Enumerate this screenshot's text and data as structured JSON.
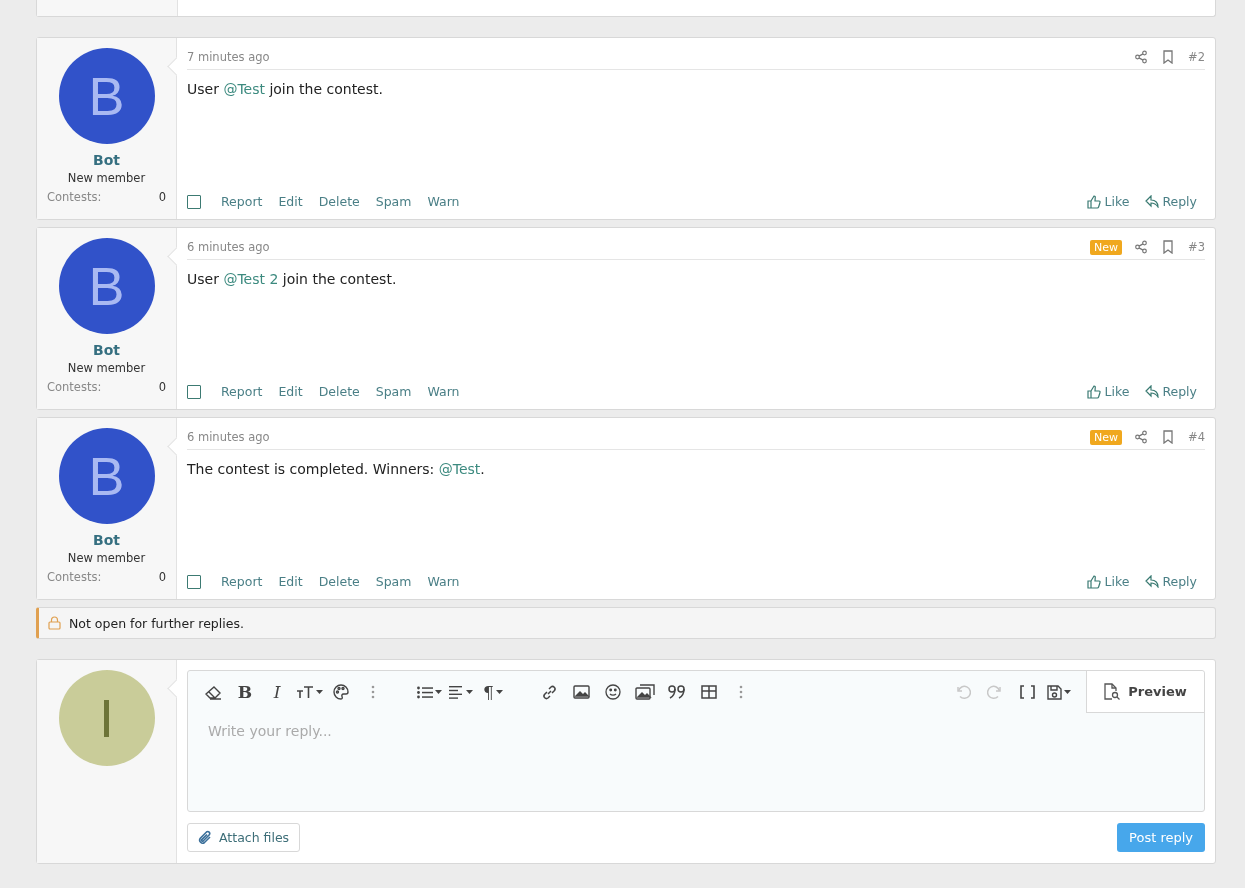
{
  "posts": [
    {
      "avatar_letter": "B",
      "username": "Bot",
      "role": "New member",
      "stat_label": "Contests:",
      "stat_value": "0",
      "time": "7 minutes ago",
      "number": "#2",
      "selected": false,
      "message": [
        {
          "kind": "text",
          "text": "User "
        },
        {
          "kind": "mention",
          "text": "@Test"
        },
        {
          "kind": "text",
          "text": " join the contest."
        }
      ],
      "actions": [
        "Report",
        "Edit",
        "Delete",
        "Spam",
        "Warn"
      ],
      "reactions": [
        "Like",
        "Reply"
      ]
    },
    {
      "avatar_letter": "B",
      "username": "Bot",
      "role": "New member",
      "stat_label": "Contests:",
      "stat_value": "0",
      "time": "6 minutes ago",
      "badge": "New",
      "number": "#3",
      "selected": false,
      "message": [
        {
          "kind": "text",
          "text": "User "
        },
        {
          "kind": "mention",
          "text": "@Test 2"
        },
        {
          "kind": "text",
          "text": " join the contest."
        }
      ],
      "actions": [
        "Report",
        "Edit",
        "Delete",
        "Spam",
        "Warn"
      ],
      "reactions": [
        "Like",
        "Reply"
      ]
    },
    {
      "avatar_letter": "B",
      "username": "Bot",
      "role": "New member",
      "stat_label": "Contests:",
      "stat_value": "0",
      "time": "6 minutes ago",
      "badge": "New",
      "number": "#4",
      "selected": false,
      "message": [
        {
          "kind": "text",
          "text": "The contest is completed. Winners: "
        },
        {
          "kind": "mention",
          "text": "@Test"
        },
        {
          "kind": "text",
          "text": "."
        }
      ],
      "actions": [
        "Report",
        "Edit",
        "Delete",
        "Spam",
        "Warn"
      ],
      "reactions": [
        "Like",
        "Reply"
      ]
    }
  ],
  "notice": "Not open for further replies.",
  "reply": {
    "avatar_letter": "I",
    "toolbar_left": [
      {
        "kind": "eraser",
        "dropdown": false
      },
      {
        "kind": "bold",
        "text": "B",
        "dropdown": false
      },
      {
        "kind": "italic",
        "text": "I",
        "dropdown": false
      },
      {
        "kind": "textsize",
        "dropdown": true
      },
      {
        "kind": "palette",
        "dropdown": false
      },
      {
        "kind": "more",
        "dropdown": false
      },
      {
        "kind": "list",
        "dropdown": true
      },
      {
        "kind": "align",
        "dropdown": true
      },
      {
        "kind": "paragraph",
        "text": "¶",
        "dropdown": true
      },
      {
        "kind": "link",
        "dropdown": false
      },
      {
        "kind": "image",
        "dropdown": false
      },
      {
        "kind": "emoji",
        "dropdown": false
      },
      {
        "kind": "media",
        "dropdown": false
      },
      {
        "kind": "quote",
        "dropdown": false
      },
      {
        "kind": "table",
        "dropdown": false
      },
      {
        "kind": "more",
        "dropdown": false
      }
    ],
    "toolbar_right": [
      {
        "kind": "undo",
        "disabled": true,
        "dropdown": false
      },
      {
        "kind": "redo",
        "disabled": true,
        "dropdown": false
      },
      {
        "kind": "brackets",
        "disabled": false,
        "dropdown": false
      },
      {
        "kind": "save",
        "disabled": false,
        "dropdown": true
      }
    ],
    "preview": "Preview",
    "placeholder": "Write your reply...",
    "attach": "Attach files",
    "submit": "Post reply"
  }
}
